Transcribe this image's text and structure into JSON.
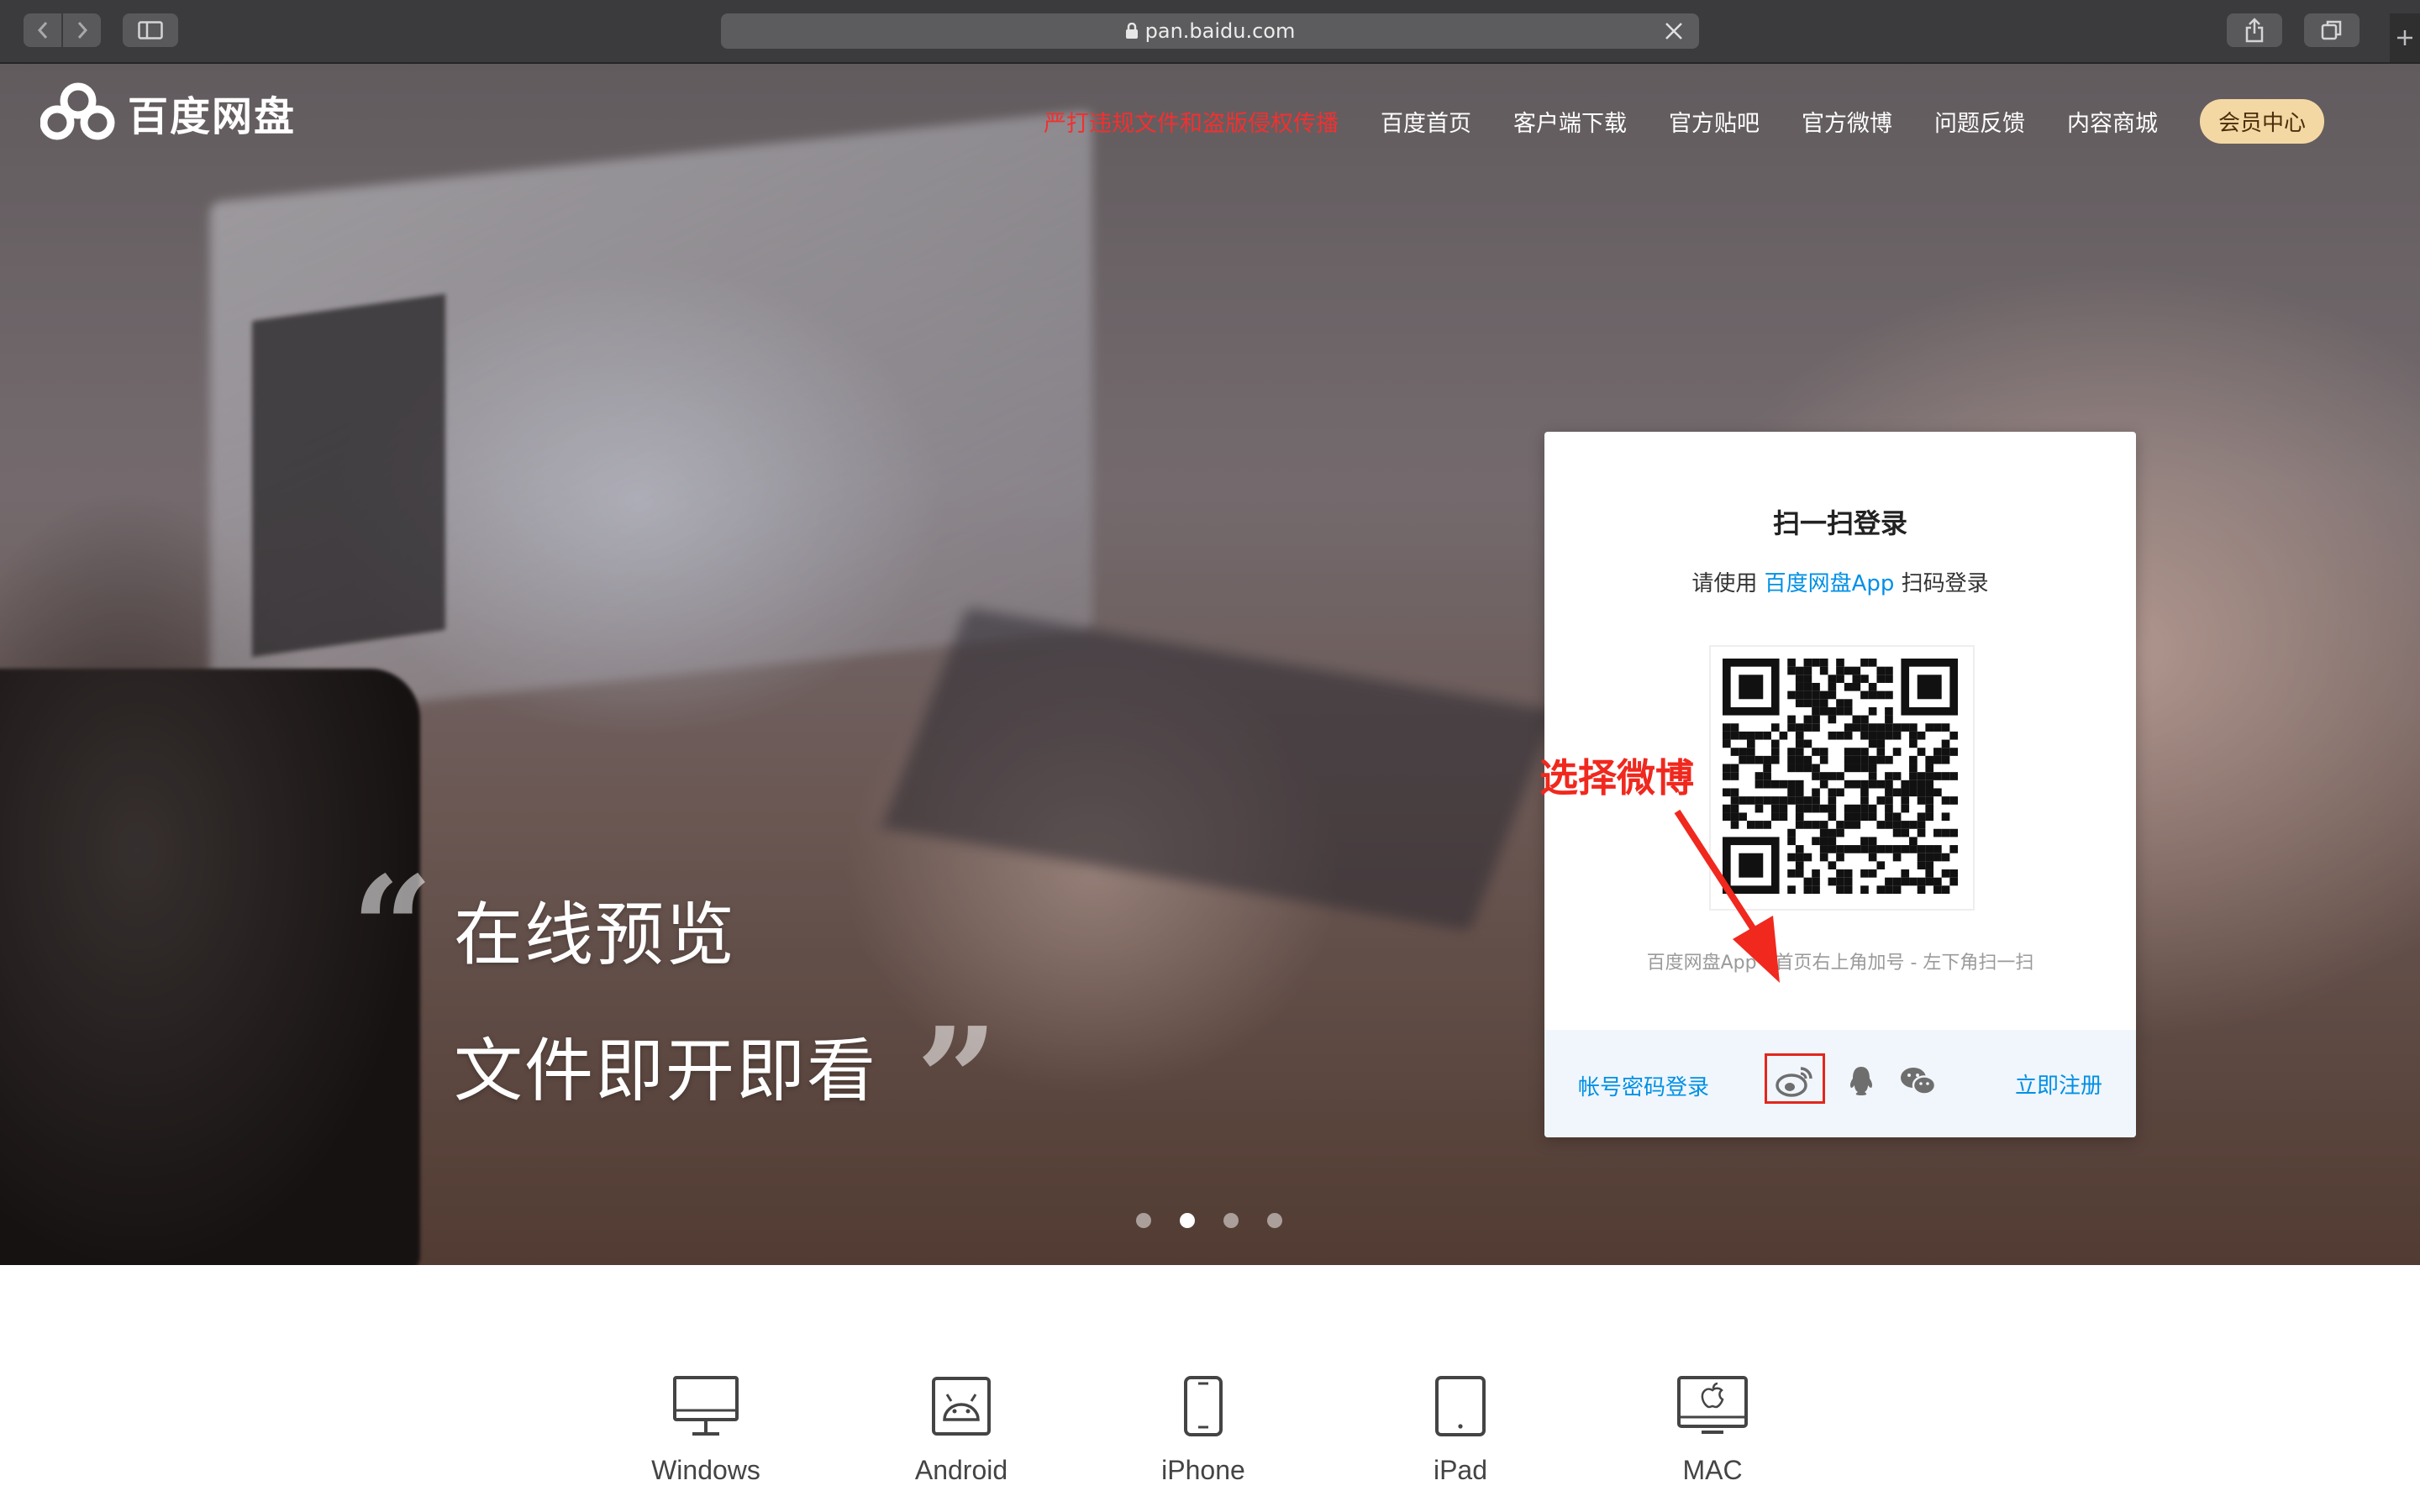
{
  "browser": {
    "url": "pan.baidu.com"
  },
  "brand": {
    "name": "百度网盘"
  },
  "nav": {
    "items": [
      {
        "label": "严打违规文件和盗版侵权传播",
        "warning": true
      },
      {
        "label": "百度首页"
      },
      {
        "label": "客户端下载"
      },
      {
        "label": "官方贴吧"
      },
      {
        "label": "官方微博"
      },
      {
        "label": "问题反馈"
      },
      {
        "label": "内容商城"
      }
    ],
    "vip": "会员中心"
  },
  "hero": {
    "line1": "在线预览",
    "line2": "文件即开即看",
    "open_quote": "“",
    "close_quote": "”",
    "slides": 4,
    "active_slide": 2
  },
  "login": {
    "title": "扫一扫登录",
    "sub_prefix": "请使用",
    "sub_app": "百度网盘App",
    "sub_suffix": "扫码登录",
    "hint": "百度网盘App - 首页右上角加号 - 左下角扫一扫",
    "account_login": "帐号密码登录",
    "register": "立即注册",
    "social_icons": [
      "weibo-icon",
      "qq-icon",
      "wechat-icon"
    ]
  },
  "annotation": {
    "text": "选择微博",
    "color": "#f0281e"
  },
  "downloads": [
    {
      "label": "Windows",
      "icon": "monitor-icon"
    },
    {
      "label": "Android",
      "icon": "android-icon"
    },
    {
      "label": "iPhone",
      "icon": "iphone-icon"
    },
    {
      "label": "iPad",
      "icon": "ipad-icon"
    },
    {
      "label": "MAC",
      "icon": "mac-icon"
    }
  ],
  "colors": {
    "link": "#0090e6",
    "warning": "#f23030",
    "vip_bg": "#f4d8a4",
    "annotation": "#e3261d"
  }
}
